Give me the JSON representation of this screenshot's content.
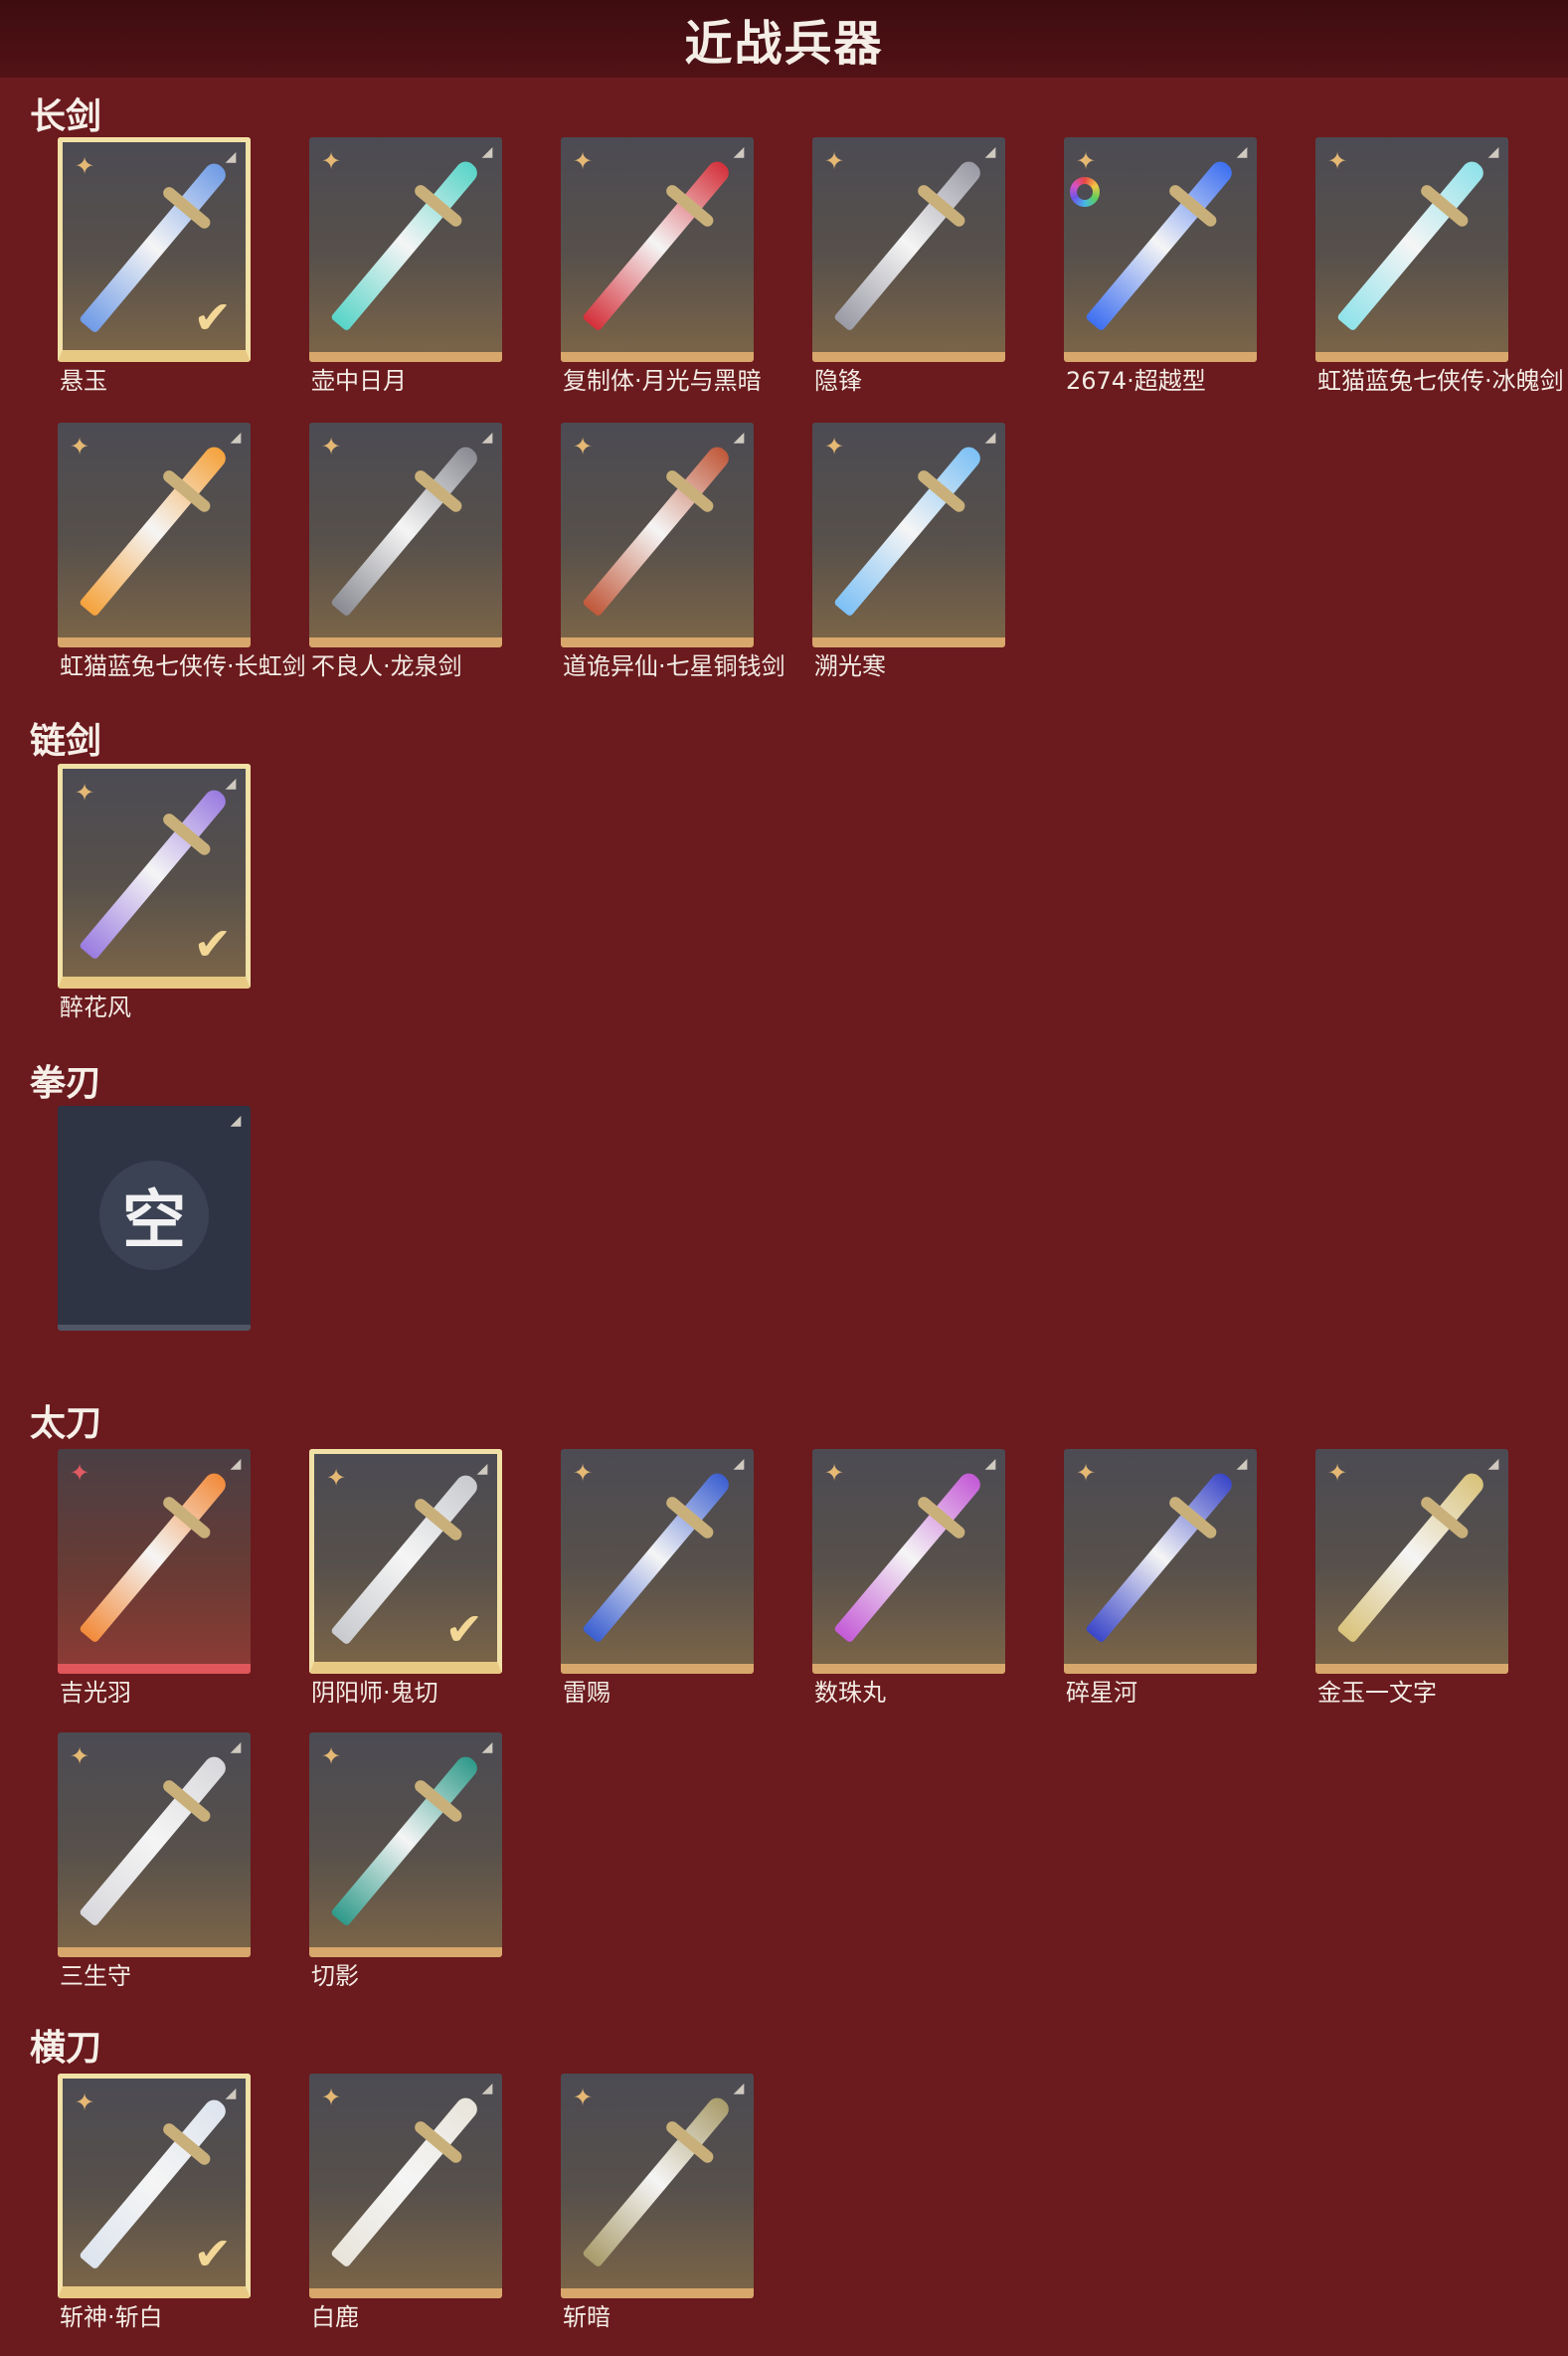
{
  "header": {
    "title": "近战兵器"
  },
  "sections": [
    {
      "title": "长剑"
    },
    {
      "title": "链剑"
    },
    {
      "title": "拳刃"
    },
    {
      "title": "太刀"
    },
    {
      "title": "横刀"
    }
  ],
  "weapons": {
    "changjian": [
      {
        "name": "悬玉",
        "selected": true,
        "blade": "#6f9be6"
      },
      {
        "name": "壶中日月",
        "selected": false,
        "blade": "#58d4c8"
      },
      {
        "name": "复制体·月光与黑暗",
        "selected": false,
        "blade": "#d4303a"
      },
      {
        "name": "隐锋",
        "selected": false,
        "blade": "#9a9aa5"
      },
      {
        "name": "2674·超越型",
        "selected": false,
        "blade": "#3d6ff0",
        "color_wheel": true
      },
      {
        "name": "虹猫蓝兔七侠传·冰魄剑",
        "selected": false,
        "blade": "#8fe2ea"
      },
      {
        "name": "虹猫蓝兔七侠传·长虹剑",
        "selected": false,
        "blade": "#f5a23b"
      },
      {
        "name": "不良人·龙泉剑",
        "selected": false,
        "blade": "#8a8b92"
      },
      {
        "name": "道诡异仙·七星铜钱剑",
        "selected": false,
        "blade": "#c0583a"
      },
      {
        "name": "溯光寒",
        "selected": false,
        "blade": "#7cc0f5"
      }
    ],
    "lianjian": [
      {
        "name": "醉花风",
        "selected": true,
        "blade": "#9a7be0"
      }
    ],
    "quanren": [
      {
        "name": "",
        "empty": true,
        "empty_text": "空"
      }
    ],
    "taidao": [
      {
        "name": "吉光羽",
        "selected": false,
        "blade": "#f28a3a",
        "rarity": "red"
      },
      {
        "name": "阴阳师·鬼切",
        "selected": true,
        "blade": "#c8cace"
      },
      {
        "name": "雷赐",
        "selected": false,
        "blade": "#3b5fd0"
      },
      {
        "name": "数珠丸",
        "selected": false,
        "blade": "#c45ad6"
      },
      {
        "name": "碎星河",
        "selected": false,
        "blade": "#3a46c8"
      },
      {
        "name": "金玉一文字",
        "selected": false,
        "blade": "#d9c27a"
      },
      {
        "name": "三生守",
        "selected": false,
        "blade": "#d8d8dc"
      },
      {
        "name": "切影",
        "selected": false,
        "blade": "#2f9a8a"
      }
    ],
    "hengdao": [
      {
        "name": "斩神·斩白",
        "selected": true,
        "blade": "#dde4ee"
      },
      {
        "name": "白鹿",
        "selected": false,
        "blade": "#e8e4da"
      },
      {
        "name": "斩暗",
        "selected": false,
        "blade": "#a89b6a"
      }
    ]
  },
  "icons": {
    "star": "four-point-star-icon",
    "corner": "edit-corner-icon",
    "check": "checkmark-icon"
  }
}
